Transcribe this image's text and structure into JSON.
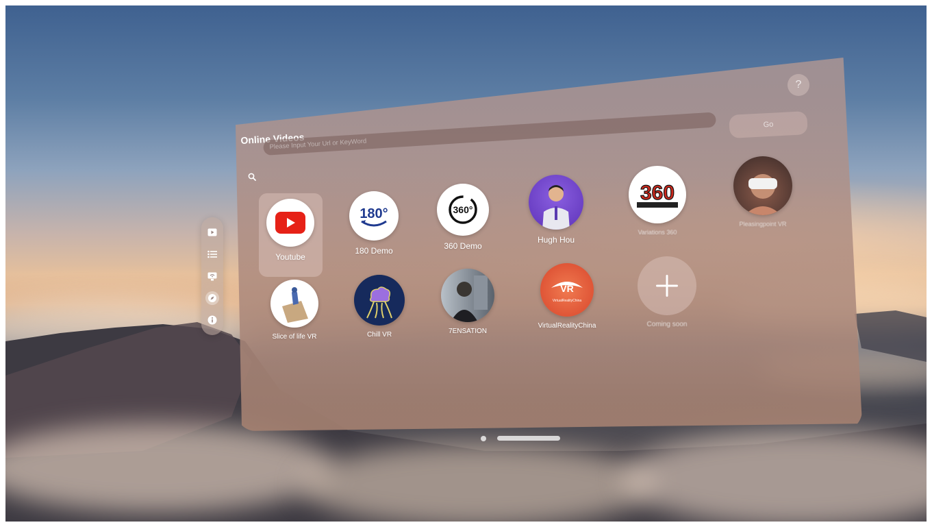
{
  "panel": {
    "title": "Online Videos",
    "search_placeholder": "Please Input Your Url or KeyWord",
    "go_label": "Go",
    "help_label": "?"
  },
  "sidebar": {
    "items": [
      {
        "icon": "play-icon"
      },
      {
        "icon": "list-icon"
      },
      {
        "icon": "screen-wifi-icon"
      },
      {
        "icon": "compass-icon"
      },
      {
        "icon": "info-icon"
      }
    ]
  },
  "tiles": [
    {
      "label": "Youtube",
      "icon": "youtube-icon",
      "color": "#e62117"
    },
    {
      "label": "180 Demo",
      "icon": "180-icon",
      "color": "#1f3a8f"
    },
    {
      "label": "360 Demo",
      "icon": "360-icon",
      "color": "#111111"
    },
    {
      "label": "Hugh Hou",
      "icon": "avatar-icon",
      "color": "#6d3fc7"
    },
    {
      "label": "Variations 360",
      "icon": "360-logo-icon",
      "color": "#cc2a1e"
    },
    {
      "label": "Pleasingpoint VR",
      "icon": "avatar-icon",
      "color": "#8a5a4a"
    },
    {
      "label": "Slice of life VR",
      "icon": "avatar-icon",
      "color": "#c8a880"
    },
    {
      "label": "Chill VR",
      "icon": "brain-icon",
      "color": "#1a2d60"
    },
    {
      "label": "7ENSATION",
      "icon": "avatar-icon",
      "color": "#2a2d33"
    },
    {
      "label": "VirtualRealityChina",
      "icon": "vr-logo-icon",
      "color": "#e4553a"
    },
    {
      "label": "Coming soon",
      "icon": "plus-icon",
      "color": "#ffffff"
    }
  ],
  "vr_logo_text": "VirtualRealityChina",
  "badge_360_text": "360",
  "badge_180_text": "180°"
}
